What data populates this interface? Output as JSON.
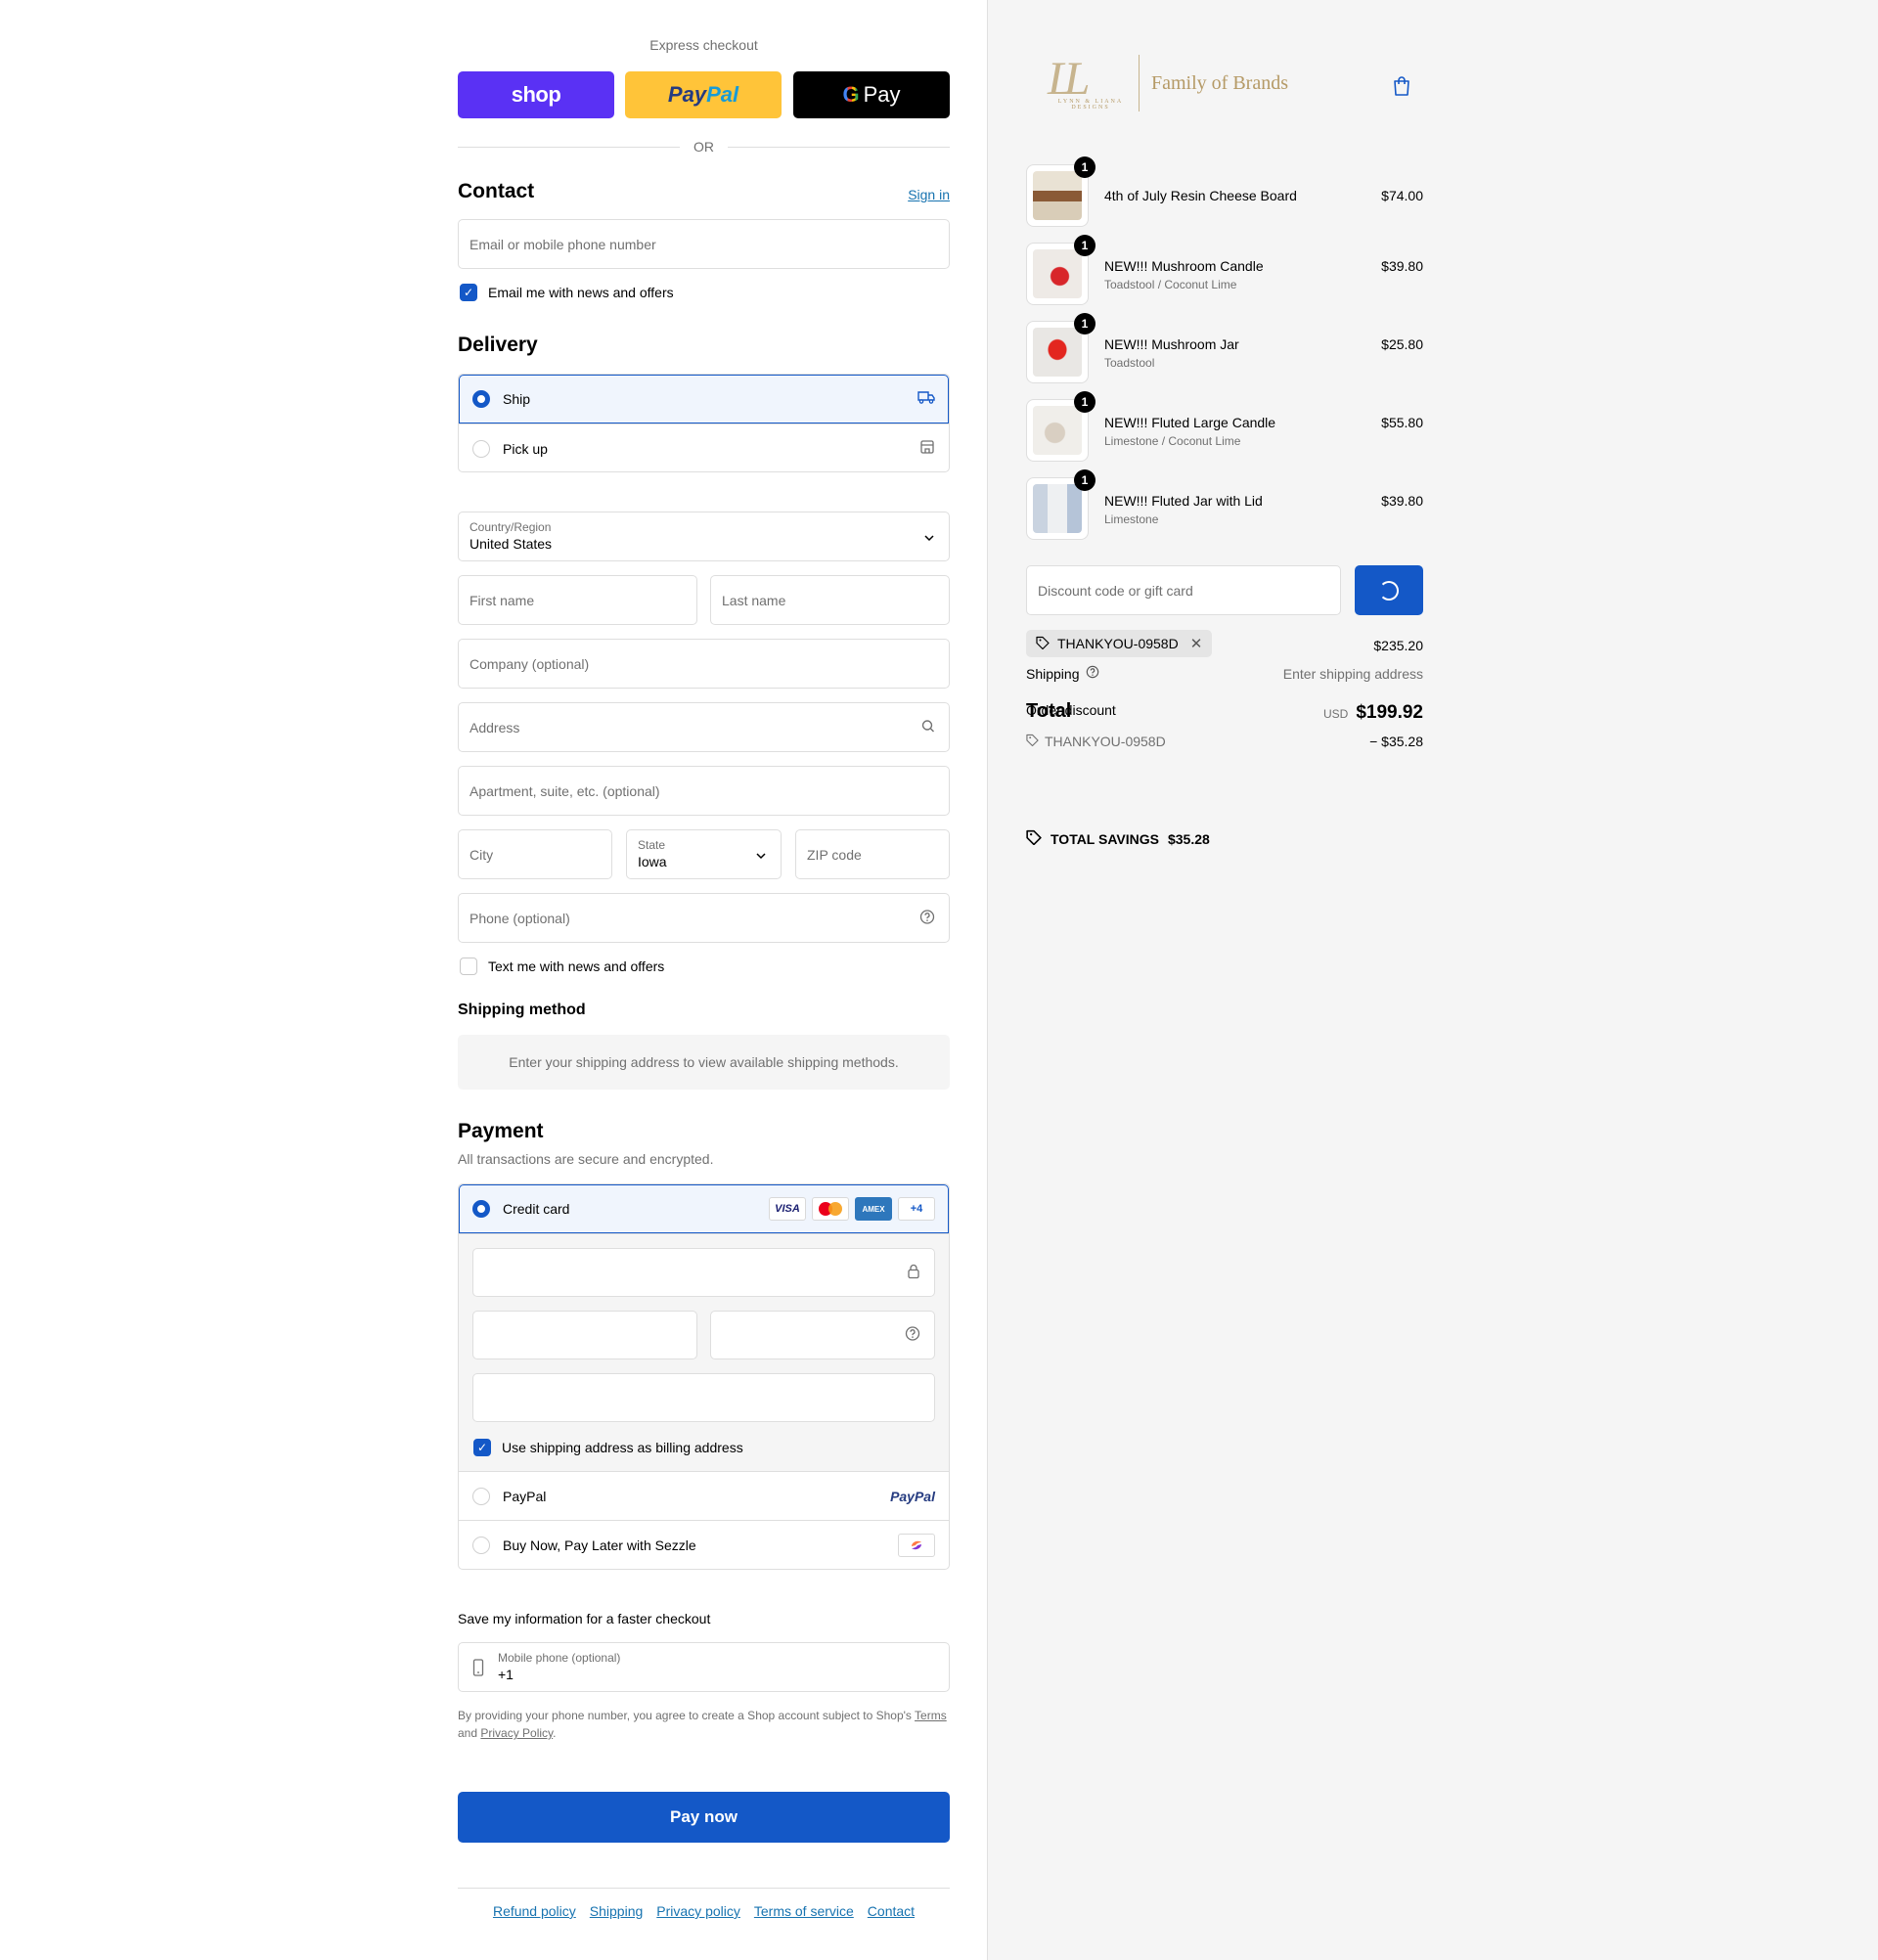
{
  "express": {
    "label": "Express checkout",
    "shop_label": "shop",
    "paypal_label_1": "Pay",
    "paypal_label_2": "Pal",
    "gpay_g": "G",
    "gpay_label": "Pay",
    "or_label": "OR"
  },
  "contact": {
    "heading": "Contact",
    "sign_in": "Sign in",
    "email_placeholder": "Email or mobile phone number",
    "news_label": "Email me with news and offers",
    "news_checked": true
  },
  "delivery": {
    "heading": "Delivery",
    "options": [
      {
        "label": "Ship",
        "selected": true,
        "icon": "truck-icon"
      },
      {
        "label": "Pick up",
        "selected": false,
        "icon": "store-icon"
      }
    ],
    "country_label": "Country/Region",
    "country_value": "United States",
    "first_name": "First name",
    "last_name": "Last name",
    "company": "Company (optional)",
    "address": "Address",
    "apartment": "Apartment, suite, etc. (optional)",
    "city": "City",
    "state_label": "State",
    "state_value": "Iowa",
    "zip": "ZIP code",
    "phone": "Phone (optional)",
    "text_label": "Text me with news and offers"
  },
  "shipping_method": {
    "heading": "Shipping method",
    "message": "Enter your shipping address to view available shipping methods."
  },
  "payment": {
    "heading": "Payment",
    "subtitle": "All transactions are secure and encrypted.",
    "credit_card": "Credit card",
    "card_brands": [
      "VISA",
      "mastercard",
      "AMEX",
      "+4"
    ],
    "billing_label": "Use shipping address as billing address",
    "paypal": "PayPal",
    "paypal_logo": "PayPal",
    "sezzle": "Buy Now, Pay Later with Sezzle"
  },
  "save_info": {
    "heading": "Save my information for a faster checkout",
    "phone_label": "Mobile phone (optional)",
    "phone_value": "+1",
    "legal_prefix": "By providing your phone number, you agree to create a Shop account subject to Shop's",
    "terms": "Terms",
    "and": "and",
    "privacy": "Privacy Policy",
    "period": "."
  },
  "pay_now": "Pay now",
  "footer_links": [
    "Refund policy",
    "Shipping",
    "Privacy policy",
    "Terms of service",
    "Contact"
  ],
  "brand": {
    "monogram": "LL",
    "monogram_sub": "LYNN & LIANA DESIGNS",
    "name": "Family of Brands"
  },
  "cart": [
    {
      "title": "4th of July Resin Cheese Board",
      "variant": "",
      "price": "$74.00",
      "qty": "1"
    },
    {
      "title": "NEW!!! Mushroom Candle",
      "variant": "Toadstool / Coconut Lime",
      "price": "$39.80",
      "qty": "1"
    },
    {
      "title": "NEW!!! Mushroom Jar",
      "variant": "Toadstool",
      "price": "$25.80",
      "qty": "1"
    },
    {
      "title": "NEW!!! Fluted Large Candle",
      "variant": "Limestone / Coconut Lime",
      "price": "$55.80",
      "qty": "1"
    },
    {
      "title": "NEW!!! Fluted Jar with Lid",
      "variant": "Limestone",
      "price": "$39.80",
      "qty": "1"
    }
  ],
  "discount": {
    "placeholder": "Discount code or gift card",
    "code": "THANKYOU-0958D"
  },
  "summary": {
    "subtotal": "$235.20",
    "shipping_label": "Shipping",
    "shipping_value": "Enter shipping address",
    "total_label": "Total",
    "order_discount_label": "Order discount",
    "currency": "USD",
    "total_value": "$199.92",
    "discount_code": "THANKYOU-0958D",
    "discount_value": "− $35.28",
    "savings_label": "TOTAL SAVINGS",
    "savings_value": "$35.28"
  },
  "colors": {
    "accent": "#1458c7",
    "shop_purple": "#5a31f4",
    "paypal_yellow": "#ffc439",
    "gold": "#b59a66"
  }
}
